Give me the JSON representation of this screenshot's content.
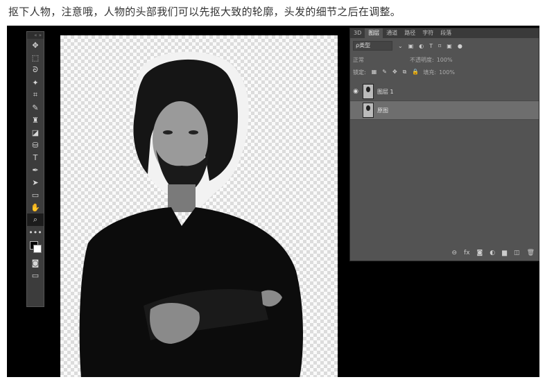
{
  "caption": "抠下人物，注意哦，人物的头部我们可以先抠大致的轮廓，头发的细节之后在调整。",
  "toolbar": {
    "head": "«  »",
    "tools": [
      {
        "name": "move-icon",
        "glyph": "✥"
      },
      {
        "name": "marquee-icon",
        "glyph": "⬚"
      },
      {
        "name": "lasso-icon",
        "glyph": "ᘐ"
      },
      {
        "name": "magic-wand-icon",
        "glyph": "✦"
      },
      {
        "name": "crop-icon",
        "glyph": "⌗"
      },
      {
        "name": "brush-icon",
        "glyph": "✎"
      },
      {
        "name": "stamp-icon",
        "glyph": "♜"
      },
      {
        "name": "eraser-icon",
        "glyph": "◪"
      },
      {
        "name": "bucket-icon",
        "glyph": "⛁"
      },
      {
        "name": "text-tool-icon",
        "glyph": "T"
      },
      {
        "name": "pen-icon",
        "glyph": "✒"
      },
      {
        "name": "path-select-icon",
        "glyph": "➤"
      },
      {
        "name": "rectangle-icon",
        "glyph": "▭"
      },
      {
        "name": "hand-icon",
        "glyph": "✋"
      },
      {
        "name": "zoom-icon",
        "glyph": "⌕"
      },
      {
        "name": "more-tools-icon",
        "glyph": "•••"
      }
    ],
    "bottom_tools": [
      {
        "name": "quick-mask-icon",
        "glyph": "◙"
      },
      {
        "name": "screen-mode-icon",
        "glyph": "▭"
      }
    ]
  },
  "panel": {
    "tabs": [
      "3D",
      "图层",
      "通道",
      "路径",
      "字符",
      "段落"
    ],
    "active_tab": 1,
    "filter_label": "ρ类型",
    "filter_icons": [
      "▣",
      "◐",
      "T",
      "⌑",
      "▣",
      "●"
    ],
    "blend_mode": "正常",
    "opacity_label": "不透明度:",
    "opacity_value": "100%",
    "lock_label": "锁定:",
    "lock_icons": [
      "▦",
      "✎",
      "✥",
      "⧉",
      "🔒"
    ],
    "fill_label": "填充:",
    "fill_value": "100%",
    "layers": [
      {
        "name": "图层 1",
        "visible": true,
        "selected": false
      },
      {
        "name": "原图",
        "visible": false,
        "selected": true
      }
    ],
    "footer_icons": [
      "⊖",
      "fx",
      "◙",
      "◐",
      "▆",
      "◫",
      "🗑"
    ]
  },
  "colors": {
    "canvas_bg": "#000000",
    "panel_bg": "#535353",
    "selected_layer": "#6e6e6e"
  }
}
